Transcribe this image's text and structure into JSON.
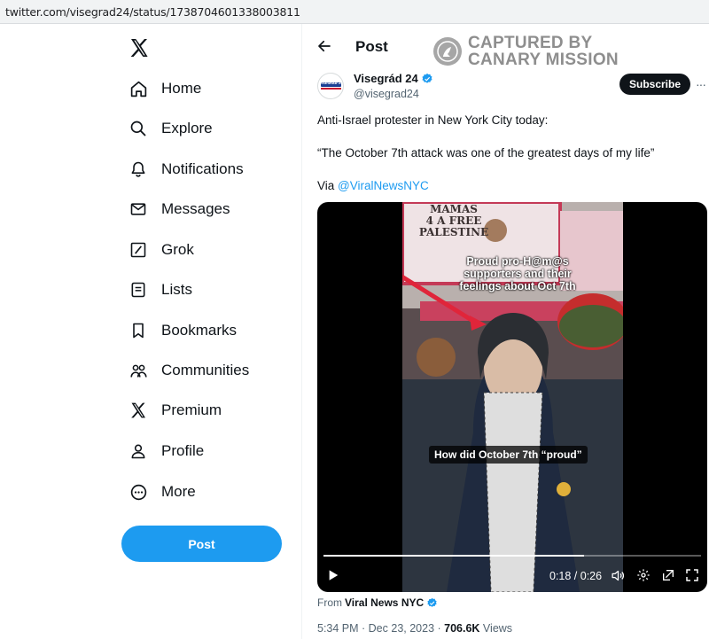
{
  "browser": {
    "url": "twitter.com/visegrad24/status/1738704601338003811"
  },
  "sidebar": {
    "logo": "x-logo-icon",
    "items": [
      {
        "label": "Home",
        "icon": "home-icon"
      },
      {
        "label": "Explore",
        "icon": "search-icon"
      },
      {
        "label": "Notifications",
        "icon": "bell-icon"
      },
      {
        "label": "Messages",
        "icon": "envelope-icon"
      },
      {
        "label": "Grok",
        "icon": "grok-icon"
      },
      {
        "label": "Lists",
        "icon": "list-icon"
      },
      {
        "label": "Bookmarks",
        "icon": "bookmark-icon"
      },
      {
        "label": "Communities",
        "icon": "people-icon"
      },
      {
        "label": "Premium",
        "icon": "x-logo-icon"
      },
      {
        "label": "Profile",
        "icon": "person-icon"
      },
      {
        "label": "More",
        "icon": "more-circle-icon"
      }
    ],
    "post_button": "Post"
  },
  "header": {
    "title": "Post",
    "watermark_line1": "CAPTURED BY",
    "watermark_line2": "CANARY MISSION"
  },
  "tweet": {
    "author_name": "Visegrád 24",
    "author_handle": "@visegrad24",
    "avatar_text": "VISEGRÁD 24",
    "subscribe_label": "Subscribe",
    "more_label": "···",
    "line1": "Anti-Israel protester in New York City today:",
    "line2": "“The October 7th attack was one of the greatest days of my life”",
    "via_prefix": "Via ",
    "via_link": "@ViralNewsNYC",
    "video": {
      "sign_text": "MAMAS\n4 A FREE\nPALESTINE",
      "caption_top": "Proud pro-H@m@s\nsupporters and their\nfeelings about Oct 7th",
      "caption_bottom": "How did October 7th “proud”",
      "time": "0:18 / 0:26",
      "progress": 0.69
    },
    "source_prefix": "From",
    "source_name": "Viral News NYC",
    "timestamp": "5:34 PM · Dec 23, 2023 · ",
    "views_count": "706.6K",
    "views_label": " Views"
  },
  "colors": {
    "accent": "#1d9bf0",
    "text": "#0f1419",
    "muted": "#536471"
  }
}
